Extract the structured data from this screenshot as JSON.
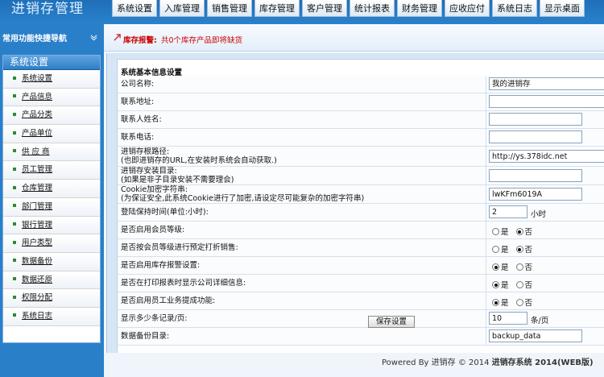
{
  "app": {
    "title": "进销存管理"
  },
  "nav": {
    "tabs": [
      "系统设置",
      "入库管理",
      "销售管理",
      "库存管理",
      "客户管理",
      "统计报表",
      "财务管理",
      "应收应付",
      "系统日志",
      "显示桌面"
    ]
  },
  "sidebar": {
    "quick_nav": "常用功能快捷导航",
    "panel_title": "系统设置",
    "items": [
      "系统设置",
      "产品信息",
      "产品分类",
      "产品单位",
      "供 应 商",
      "员工管理",
      "仓库管理",
      "部门管理",
      "银行管理",
      "用户类型",
      "数据备份",
      "数据还原",
      "权限分配",
      "系统日志"
    ]
  },
  "alert": {
    "label": "库存报警:",
    "text": "共0个库存产品即将缺货"
  },
  "form": {
    "section_title": "系统基本信息设置",
    "company_name": {
      "label": "公司名称:",
      "value": "我的进销存"
    },
    "address": {
      "label": "联系地址:",
      "value": ""
    },
    "contact_name": {
      "label": "联系人姓名:",
      "value": ""
    },
    "phone": {
      "label": "联系电话:",
      "value": ""
    },
    "path": {
      "label": "进销存根路径:",
      "hint": "(也即进销存的URL,在安装时系统会自动获取.)",
      "value": "http://ys.378idc.net"
    },
    "install_dir": {
      "label": "进销存安装目录:",
      "hint": "(如果是非子目录安装不需要理会)",
      "value": ""
    },
    "cookie": {
      "label": "Cookie加密字符串:",
      "hint": "(为保证安全,此系统Cookie进行了加密,请设定尽可能复杂的加密字符串)",
      "value": "lwKFm6019A"
    },
    "login_hours": {
      "label": "登陆保持时间(单位:小时):",
      "value": "2",
      "unit": "小时"
    },
    "member_level": {
      "label": "是否启用会员等级:",
      "yes": "是",
      "no": "否",
      "selected": "no"
    },
    "level_discount": {
      "label": "是否按会员等级进行预定打折销售:",
      "yes": "是",
      "no": "否",
      "selected": "no"
    },
    "stock_alert": {
      "label": "是否启用库存报警设置:",
      "yes": "是",
      "no": "否",
      "selected": "yes"
    },
    "print_company": {
      "label": "是否在打印报表时显示公司详细信息:",
      "yes": "是",
      "no": "否",
      "selected": "yes"
    },
    "commission": {
      "label": "是否启用员工业务提成功能:",
      "yes": "是",
      "no": "否",
      "selected": "yes"
    },
    "per_page": {
      "label": "显示多少条记录/页:",
      "value": "10",
      "unit": "条/页"
    },
    "backup_dir": {
      "label": "数据备份目录:",
      "value": "backup_data"
    },
    "save_label": "保存设置"
  },
  "footer": {
    "powered": "Powered By 进销存 © 2014",
    "product": "进销存系统 2014(WEB版)"
  }
}
